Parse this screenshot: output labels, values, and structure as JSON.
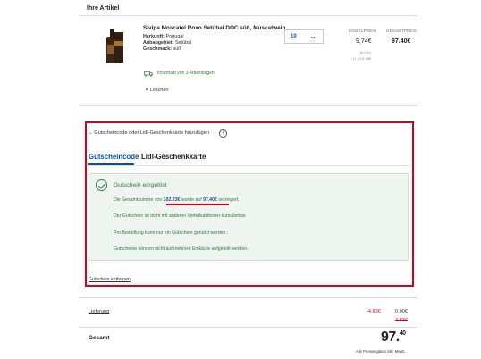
{
  "section": {
    "title": "Ihre Artikel"
  },
  "product": {
    "name": "Sivipa Moscatel Roxo Setúbal DOC süß, Muscatwein",
    "attributes": [
      {
        "label": "Herkunft:",
        "value": "Portugal"
      },
      {
        "label": "Anbaugebiet:",
        "value": "Setúbal"
      },
      {
        "label": "Geschmack:",
        "value": "süß"
      }
    ],
    "quantity": "10",
    "unit_price_header": "EINZELPREIS",
    "total_price_header": "GESAMTPREIS",
    "unit_price": "9,74€",
    "total_price": "97.40€",
    "unit_size": "je 0,5-l",
    "base_price": "1 l = 19.48€",
    "delivery_text": "Innerhalb von 3 Arbeitstagen",
    "remove_label": "Löschen"
  },
  "voucher": {
    "toggle_label": "Gutscheincode oder Lidl-Geschenkkarte hinzufügen",
    "info_icon": "i",
    "tabs": [
      {
        "label": "Gutscheincode",
        "active": true
      },
      {
        "label": "Lidl-Geschenkkarte",
        "active": false
      }
    ],
    "success_title": "Gutschein eingelöst",
    "line1_prefix": "Die Gesamtsumme von ",
    "line1_old": "102.23€",
    "line1_mid": " wurde auf ",
    "line1_new": "97.40€",
    "line1_suffix": " verringert.",
    "line2": "Der Gutschein ist nicht mit anderen Vorteilsaktionen kumulierbar.",
    "line3": "Pro Bestellung kann nur ein Gutschein genutzt werden.",
    "line4": "Gutscheine können nicht auf mehrere Einkäufe aufgeteilt werden.",
    "remove_link": "Gutschein entfernen"
  },
  "summary": {
    "delivery_label": "Lieferung",
    "delivery_discount": "-4.83€",
    "delivery_new": "0.00€",
    "delivery_old": "4.83€",
    "total_label": "Gesamt",
    "total_main": "97.",
    "total_cents": "40",
    "vat_note": "Alle Preisangaben inkl. MwSt."
  },
  "colors": {
    "accent_blue": "#0050aa",
    "success_green": "#2b7d3a",
    "highlight_red": "#d6001c"
  }
}
